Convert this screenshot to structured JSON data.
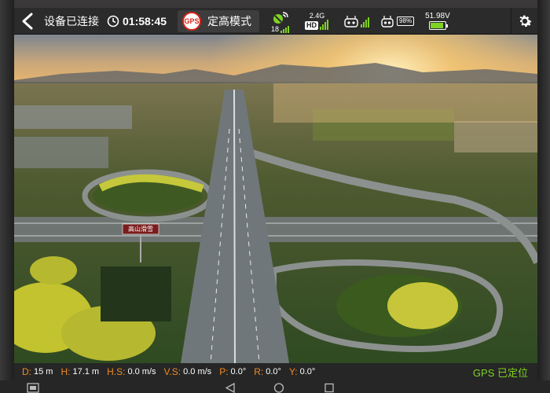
{
  "topbar": {
    "back_icon": "chevron-left-icon",
    "connection_status": "设备已连接",
    "flight_time": "01:58:45",
    "mode_badge": "GPS",
    "flight_mode": "定高模式",
    "satellite_icon": "satellite-dish-icon",
    "satellite_count": "18",
    "video_band": "2.4G",
    "video_quality": "HD",
    "rc_icon": "remote-controller-icon",
    "drone_icon": "drone-battery-icon",
    "drone_battery_pct": "98%",
    "battery_voltage": "51.98V",
    "battery_level": 0.9,
    "settings_icon": "gear-icon"
  },
  "telemetry": {
    "items": [
      {
        "key": "D:",
        "value": "15 m"
      },
      {
        "key": "H:",
        "value": "17.1 m"
      },
      {
        "key": "H.S:",
        "value": "0.0 m/s"
      },
      {
        "key": "V.S:",
        "value": "0.0 m/s"
      },
      {
        "key": "P:",
        "value": "0.0°"
      },
      {
        "key": "R:",
        "value": "0.0°"
      },
      {
        "key": "Y:",
        "value": "0.0°"
      }
    ],
    "gps_status": "GPS 已定位"
  },
  "feed": {
    "billboard_text": "高山滑雪"
  },
  "colors": {
    "accent_orange": "#f08a24",
    "signal_green": "#7ed321",
    "bar_bg": "#2b2b2b"
  },
  "navbar": {
    "icons": [
      "screenshot-icon",
      "back-triangle-icon",
      "home-circle-icon",
      "recents-square-icon"
    ]
  }
}
